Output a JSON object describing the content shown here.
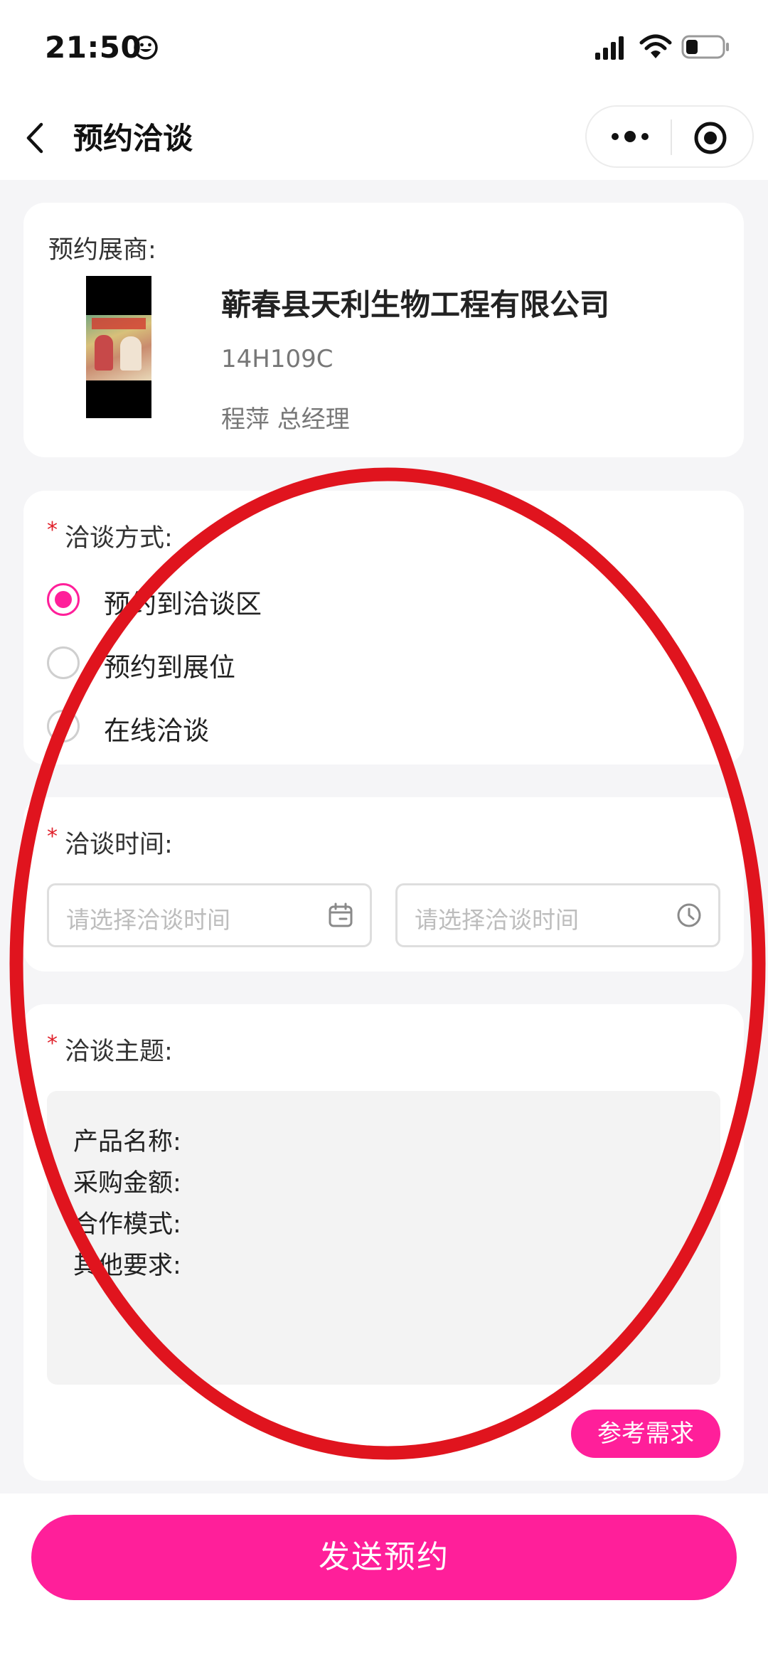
{
  "status_bar": {
    "time": "21:50"
  },
  "nav": {
    "title": "预约洽谈"
  },
  "exhibitor": {
    "label": "预约展商:",
    "company": "蕲春县天利生物工程有限公司",
    "booth": "14H109C",
    "contact": "程萍  总经理"
  },
  "method": {
    "label": "洽谈方式:",
    "options": [
      {
        "label": "预约到洽谈区",
        "checked": true
      },
      {
        "label": "预约到展位",
        "checked": false
      },
      {
        "label": "在线洽谈",
        "checked": false
      }
    ]
  },
  "time": {
    "label": "洽谈时间:",
    "date_placeholder": "请选择洽谈时间",
    "clock_placeholder": "请选择洽谈时间"
  },
  "subject": {
    "label": "洽谈主题:",
    "lines": [
      "产品名称:",
      "采购金额:",
      "合作模式:",
      "其他要求:"
    ],
    "reference_button": "参考需求"
  },
  "footer": {
    "send_button": "发送预约"
  },
  "colors": {
    "accent": "#ff1f9a",
    "required": "#e0202a",
    "annotation": "#e0141e"
  },
  "icons": [
    "smile-icon",
    "signal-icon",
    "wifi-icon",
    "battery-icon",
    "back-icon",
    "more-icon",
    "target-icon",
    "calendar-icon",
    "clock-icon"
  ]
}
